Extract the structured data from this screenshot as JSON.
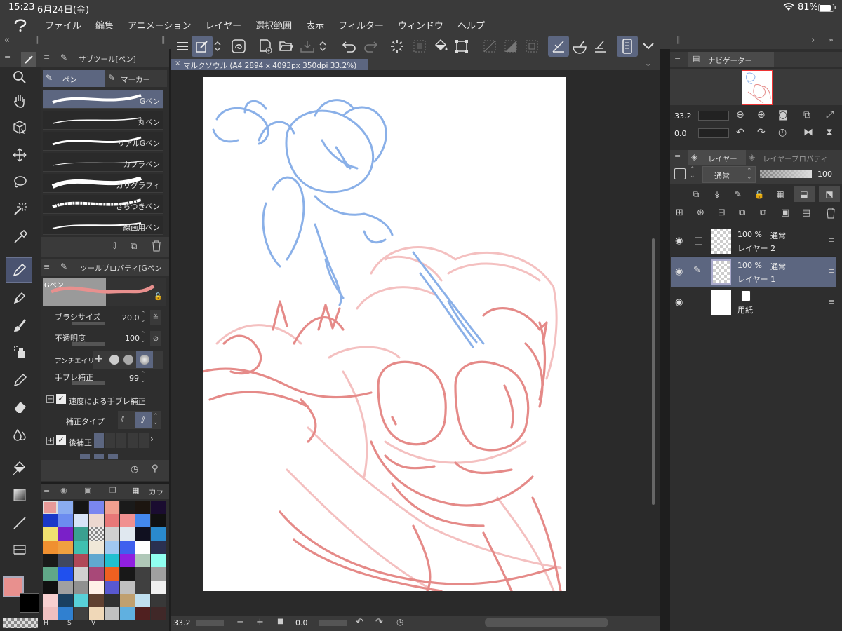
{
  "status": {
    "time": "15:23",
    "date": "6月24日(金)",
    "battery": "81%"
  },
  "menu": [
    "ファイル",
    "編集",
    "アニメーション",
    "レイヤー",
    "選択範囲",
    "表示",
    "フィルター",
    "ウィンドウ",
    "ヘルプ"
  ],
  "subtool": {
    "title": "サブツール[ペン]",
    "tabs": [
      "ペン",
      "マーカー"
    ],
    "pens": [
      "Gペン",
      "丸ペン",
      "リアルGペン",
      "カブラペン",
      "カリグラフィ",
      "ざらつきペン",
      "線画用ペン"
    ],
    "selected": 0
  },
  "toolprop": {
    "title": "ツールプロパティ[Gペン",
    "preview_label": "Gペン",
    "brush_size_label": "ブラシサイズ",
    "brush_size": "20.0",
    "opacity_label": "不透明度",
    "opacity": "100",
    "antialias_label": "アンチエイリ",
    "stabilization_label": "手ブレ補正",
    "stabilization": "99",
    "speed_stab_label": "速度による手ブレ補正",
    "correction_type_label": "補正タイプ",
    "post_correction_label": "後補正"
  },
  "color_panel": {
    "tab_label": "カラ",
    "main_color": "#e8908e",
    "sub_color": "#000000",
    "hsv": [
      "H",
      "S",
      "V"
    ],
    "swatches": [
      "#e89a98",
      "#8aacf0",
      "#151515",
      "#7a86f0",
      "#f0a090",
      "#1a1a1a",
      "#1c1510",
      "#1a0c30",
      "#1a38c8",
      "#6c8cf0",
      "#d8e4f8",
      "#ecd8d0",
      "#e87878",
      "#f09090",
      "#4488ee",
      "#101010",
      "#f0e070",
      "#7a20c8",
      "#3aa090",
      "#checker",
      "#d0d0d0",
      "#e0e8f0",
      "#101020",
      "#2a8acc",
      "#f09030",
      "#f0a040",
      "#40c0b0",
      "#f0e8d8",
      "#a0c8f0",
      "#4060ee",
      "#ffffff",
      "#2a3050",
      "#1a1a1a",
      "#404860",
      "#b04858",
      "#60a8d0",
      "#20c0d0",
      "#9020e0",
      "#b0c8b8",
      "#90fff0",
      "#60a888",
      "#2050ee",
      "#d0d0d0",
      "#a84878",
      "#f06020",
      "#181818",
      "#404040",
      "#a0a0a0",
      "#101010",
      "#a0a0a0",
      "#909090",
      "#fff0e8",
      "#5858d0",
      "#c0c0c0",
      "#404040",
      "#f0f0f0",
      "#f8d0d0",
      "#1a4060",
      "#58d0d8",
      "#604030",
      "#303030",
      "#c0a070",
      "#c0e0f0",
      "#383838",
      "#f0c0c0",
      "#3080d0",
      "#404040",
      "#f0d8b8",
      "#c0c0c0",
      "#60b0e0",
      "#502020",
      "#402828"
    ]
  },
  "canvas": {
    "tab_title": "マルクソウル (A4 2894 x 4093px 350dpi 33.2%)"
  },
  "bottom": {
    "zoom": "33.2",
    "rotation": "0.0"
  },
  "navigator": {
    "title": "ナビゲーター",
    "zoom": "33.2",
    "rotation": "0.0"
  },
  "layers": {
    "tab_label": "レイヤー",
    "tab2_label": "レイヤープロパティ",
    "blend": "通常",
    "opacity": "100",
    "items": [
      {
        "pct": "100 %",
        "blend": "通常",
        "name": "レイヤー 2"
      },
      {
        "pct": "100 %",
        "blend": "通常",
        "name": "レイヤー 1"
      },
      {
        "name": "用紙"
      }
    ]
  }
}
